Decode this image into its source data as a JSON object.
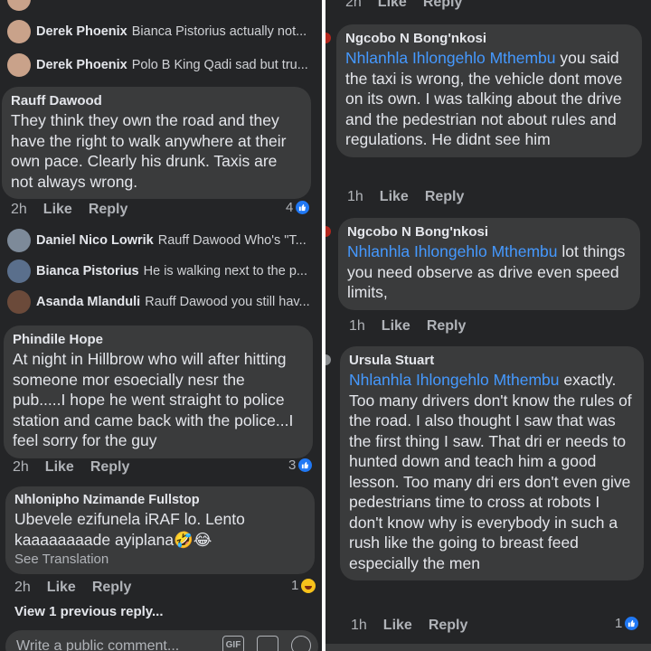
{
  "left": {
    "mini_replies_top": [
      {
        "name": "Derek Phoenix",
        "text": "Bianca Pistorius actually not...",
        "avatar_color": "#c9a28a"
      },
      {
        "name": "Derek Phoenix",
        "text": "Polo B King Qadi sad but tru...",
        "avatar_color": "#c9a28a"
      }
    ],
    "comment1": {
      "name": "Rauff Dawood",
      "text": "They think they own the road and they have the right to walk anywhere at their own pace. Clearly his drunk. Taxis are not always wrong.",
      "time": "2h",
      "like": "Like",
      "reply": "Reply",
      "reactions": "4"
    },
    "mini_replies_mid": [
      {
        "name": "Daniel Nico Lowrik",
        "text": "Rauff Dawood Who's \"T...",
        "avatar_color": "#7d8a99"
      },
      {
        "name": "Bianca Pistorius",
        "text": "He is walking next to the p...",
        "avatar_color": "#5a6f8c"
      },
      {
        "name": "Asanda Mlanduli",
        "text": "Rauff Dawood you still hav...",
        "avatar_color": "#6b4a3a"
      }
    ],
    "comment2": {
      "name": "Phindile Hope",
      "text": "At night in Hillbrow who will after hitting someone mor esoecially nesr the pub.....I hope he went straight to police station and came back with the police...I feel sorry for the guy",
      "time": "2h",
      "like": "Like",
      "reply": "Reply",
      "reactions": "3"
    },
    "comment3": {
      "name": "Nhlonipho Nzimande Fullstop",
      "text": "Ubevele ezifunela iRAF lo. Lento kaaaaaaaade ayiplana🤣😂",
      "see_translation": "See Translation",
      "time": "2h",
      "like": "Like",
      "reply": "Reply",
      "reactions": "1"
    },
    "view_previous": "View 1 previous reply...",
    "composer_placeholder": "Write a public comment...",
    "composer_icons": {
      "gif": "GIF",
      "sticker": "sticker-icon",
      "emoji": "emoji-icon"
    }
  },
  "right": {
    "top_actions": {
      "time": "2h",
      "like": "Like",
      "reply": "Reply"
    },
    "comment1": {
      "name": "Ngcobo N Bong'nkosi",
      "mention": "Nhlanhla Ihlongehlo Mthembu",
      "text": " you said the taxi is wrong, the vehicle dont move on its own. I was talking about the drive and the pedestrian not about rules and regulations. He didnt see him",
      "time": "1h",
      "like": "Like",
      "reply": "Reply"
    },
    "comment2": {
      "name": "Ngcobo N Bong'nkosi",
      "mention": "Nhlanhla Ihlongehlo Mthembu",
      "text": " lot things you need observe as drive even speed limits,",
      "time": "1h",
      "like": "Like",
      "reply": "Reply"
    },
    "comment3": {
      "name": "Ursula Stuart",
      "mention": "Nhlanhla Ihlongehlo Mthembu",
      "text": " exactly. Too many drivers don't know the rules of the road.  I also thought I saw that was  the first thing I saw. That dri er needs to hunted down and teach him a good lesson. Too many dri ers don't even give pedestrians time to cross at robots I don't know why is everybody in such a rush like the going to breast feed especially the men",
      "time": "1h",
      "like": "Like",
      "reply": "Reply",
      "reactions": "1"
    }
  },
  "colors": {
    "background": "#242527",
    "bubble": "#3a3b3c",
    "mention": "#4599ff",
    "like_blue": "#2078f4"
  }
}
